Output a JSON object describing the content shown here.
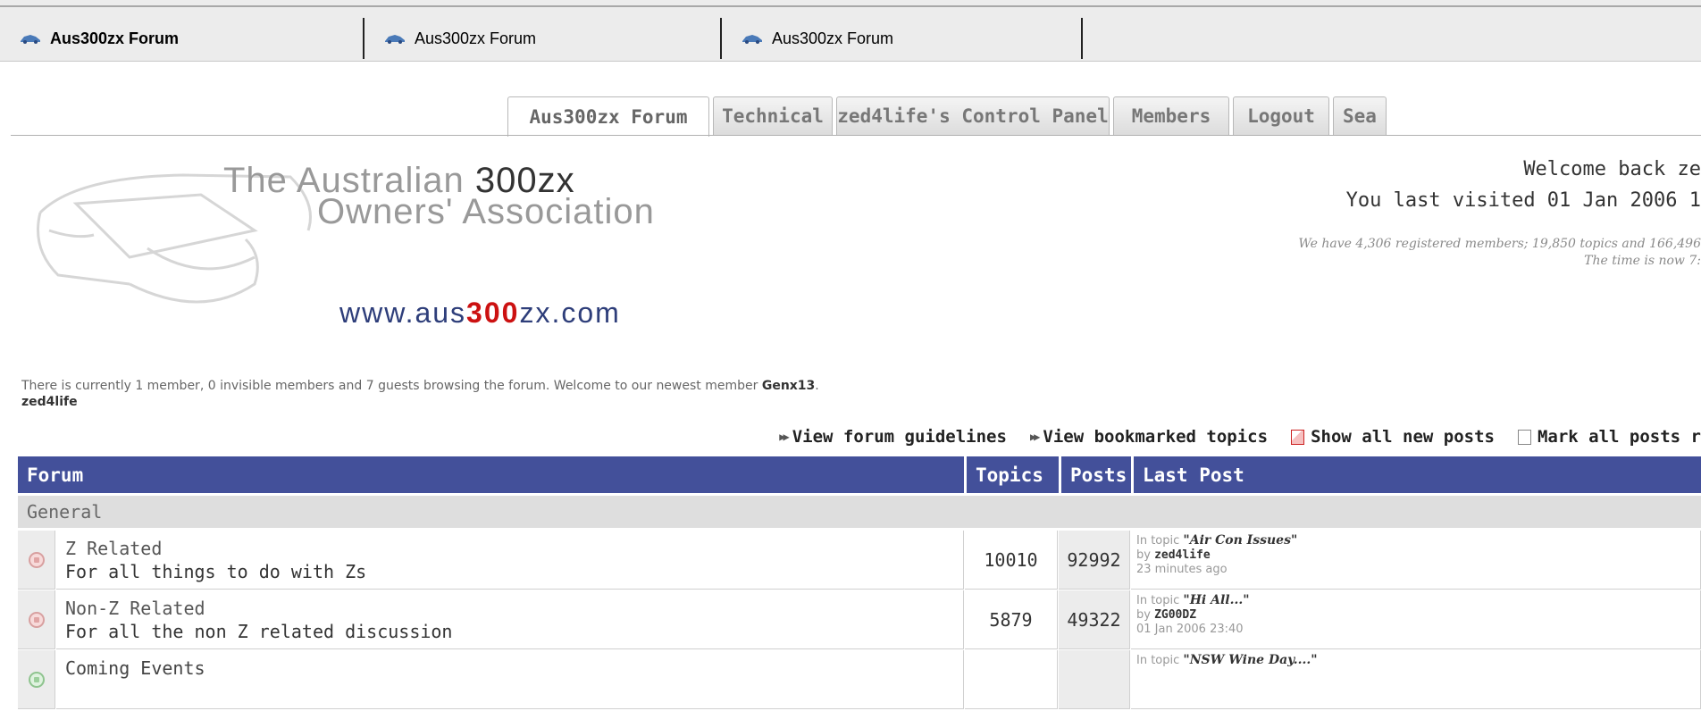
{
  "browser_tabs": [
    {
      "label": "Aus300zx Forum",
      "active": true
    },
    {
      "label": "Aus300zx Forum",
      "active": false
    },
    {
      "label": "Aus300zx Forum",
      "active": false
    }
  ],
  "nav_tabs": [
    {
      "label": "Aus300zx Forum",
      "active": true
    },
    {
      "label": "Technical",
      "active": false
    },
    {
      "label": "zed4life's Control Panel",
      "active": false
    },
    {
      "label": "Members",
      "active": false
    },
    {
      "label": "Logout",
      "active": false
    },
    {
      "label": "Sea",
      "active": false
    }
  ],
  "logo": {
    "line1_prefix": "The Australian ",
    "line1_emph": "300zx",
    "line2": "Owners' Association",
    "url_pre": "www.aus",
    "url_red": "300",
    "url_post": "zx.com"
  },
  "welcome": {
    "line1": "Welcome back ze",
    "line2": "You last visited 01 Jan 2006 1"
  },
  "stats": {
    "line1": "We have 4,306 registered members; 19,850 topics and 166,496",
    "line2": "The time is now 7:"
  },
  "online": {
    "text": "There is currently 1 member, 0 invisible members and 7 guests browsing the forum. Welcome to our newest member ",
    "newest_member": "Genx13",
    "after": ".",
    "user": "zed4life"
  },
  "links": {
    "guidelines": "View forum guidelines",
    "bookmarked": "View bookmarked topics",
    "new_posts": "Show all new posts",
    "mark_read": "Mark all posts r"
  },
  "table": {
    "headers": {
      "forum": "Forum",
      "topics": "Topics",
      "posts": "Posts",
      "last_post": "Last Post"
    },
    "category": "General",
    "rows": [
      {
        "name": "Z Related",
        "desc": "For all things to do with Zs",
        "topics": "10010",
        "posts": "92992",
        "lp_prefix": "In topic ",
        "lp_title": "\"Air Con Issues\"",
        "lp_by": "by ",
        "lp_user": "zed4life",
        "lp_time": "23 minutes ago"
      },
      {
        "name": "Non-Z Related",
        "desc": "For all the non Z related discussion",
        "topics": "5879",
        "posts": "49322",
        "lp_prefix": "In topic ",
        "lp_title": "\"Hi All...\"",
        "lp_by": "by ",
        "lp_user": "ZG00DZ",
        "lp_time": "01 Jan 2006 23:40"
      },
      {
        "name": "Coming Events",
        "desc": "",
        "topics": "",
        "posts": "",
        "lp_prefix": "In topic ",
        "lp_title": "\"NSW Wine Day....\"",
        "lp_by": "",
        "lp_user": "",
        "lp_time": ""
      }
    ]
  },
  "colors": {
    "header_bg": "#43509a",
    "category_bg": "#dedede",
    "url_red": "#cc1111",
    "url_blue": "#2e3e7a"
  }
}
